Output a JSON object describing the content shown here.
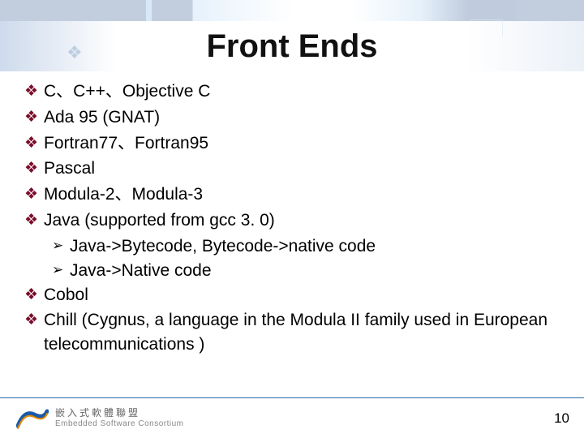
{
  "title": "Front Ends",
  "bullets": [
    {
      "text": "C、C++、Objective C"
    },
    {
      "text": "Ada 95 (GNAT)"
    },
    {
      "text": "Fortran77、Fortran95"
    },
    {
      "text": "Pascal"
    },
    {
      "text": "Modula-2、Modula-3"
    },
    {
      "text": "Java (supported from gcc 3. 0)",
      "subs": [
        "Java->Bytecode, Bytecode->native code",
        "Java->Native code"
      ]
    },
    {
      "text": "Cobol"
    },
    {
      "text": "Chill (Cygnus, a language in the Modula II family used in European telecommunications )"
    }
  ],
  "footer": {
    "org_cn": "嵌入式軟體聯盟",
    "org_en": "Embedded Software Consortium"
  },
  "page_number": "10"
}
